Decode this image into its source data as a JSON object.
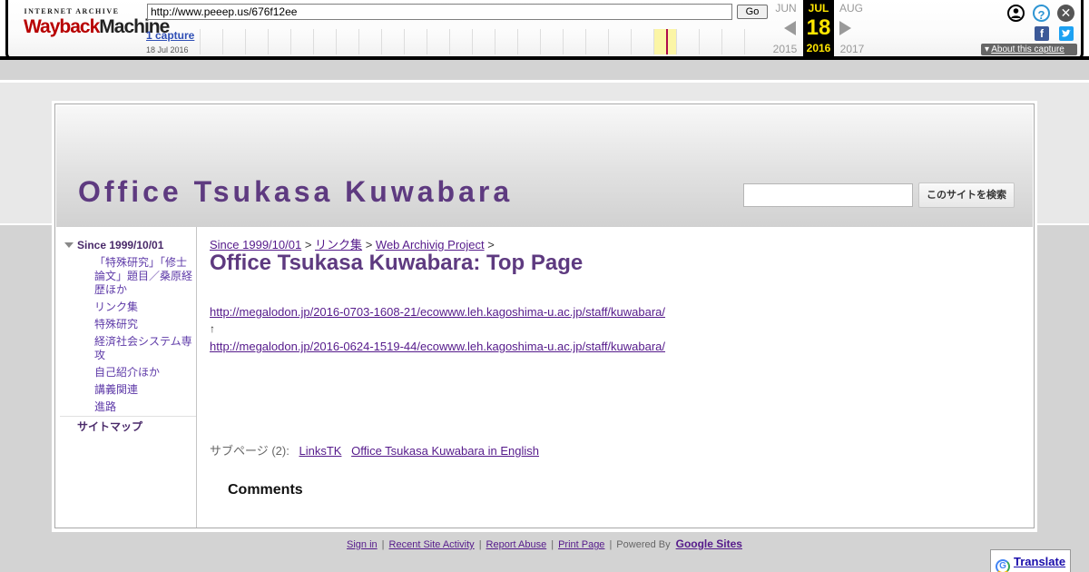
{
  "wayback": {
    "logo_top": "INTERNET ARCHIVE",
    "logo_main_a": "Wayback",
    "logo_main_b": "Machine",
    "url": "http://www.peeep.us/676f12ee",
    "go_label": "Go",
    "captures": "1 capture",
    "capture_date": "18 Jul 2016",
    "prev_month": "JUN",
    "prev_year": "2015",
    "cur_month": "JUL",
    "cur_day": "18",
    "cur_year": "2016",
    "next_month": "AUG",
    "next_year": "2017",
    "about_label": "About this capture"
  },
  "site": {
    "title": "Office Tsukasa Kuwabara",
    "search_button": "このサイトを検索",
    "search_placeholder": ""
  },
  "sidebar": {
    "root": "Since 1999/10/01",
    "items": [
      {
        "label": "「特殊研究」「修士論文」題目／桑原経歴ほか"
      },
      {
        "label": "リンク集"
      },
      {
        "label": "特殊研究"
      },
      {
        "label": "経済社会システム専攻"
      },
      {
        "label": "自己紹介ほか"
      },
      {
        "label": "講義関連"
      },
      {
        "label": "進路"
      }
    ],
    "sitemap": "サイトマップ"
  },
  "main": {
    "breadcrumb": {
      "crumb1": "Since 1999/10/01",
      "crumb2": "リンク集",
      "crumb3": "Web Archivig Project",
      "sep": ">"
    },
    "page_title": "Office Tsukasa Kuwabara: Top Page",
    "link1": "http://megalodon.jp/2016-0703-1608-21/ecowww.leh.kagoshima-u.ac.jp/staff/kuwabara/",
    "arrow": "↑",
    "link2": "http://megalodon.jp/2016-0624-1519-44/ecowww.leh.kagoshima-u.ac.jp/staff/kuwabara/",
    "subpages_label": "サブページ (2):",
    "subpage1": "LinksTK",
    "subpage2": "Office Tsukasa Kuwabara in English",
    "comments": "Comments"
  },
  "footer": {
    "sign_in": "Sign in",
    "recent": "Recent Site Activity",
    "report": "Report Abuse",
    "print": "Print Page",
    "powered": "Powered By",
    "google_sites": "Google Sites",
    "sep": "|"
  },
  "translate": {
    "label": "Translate"
  }
}
